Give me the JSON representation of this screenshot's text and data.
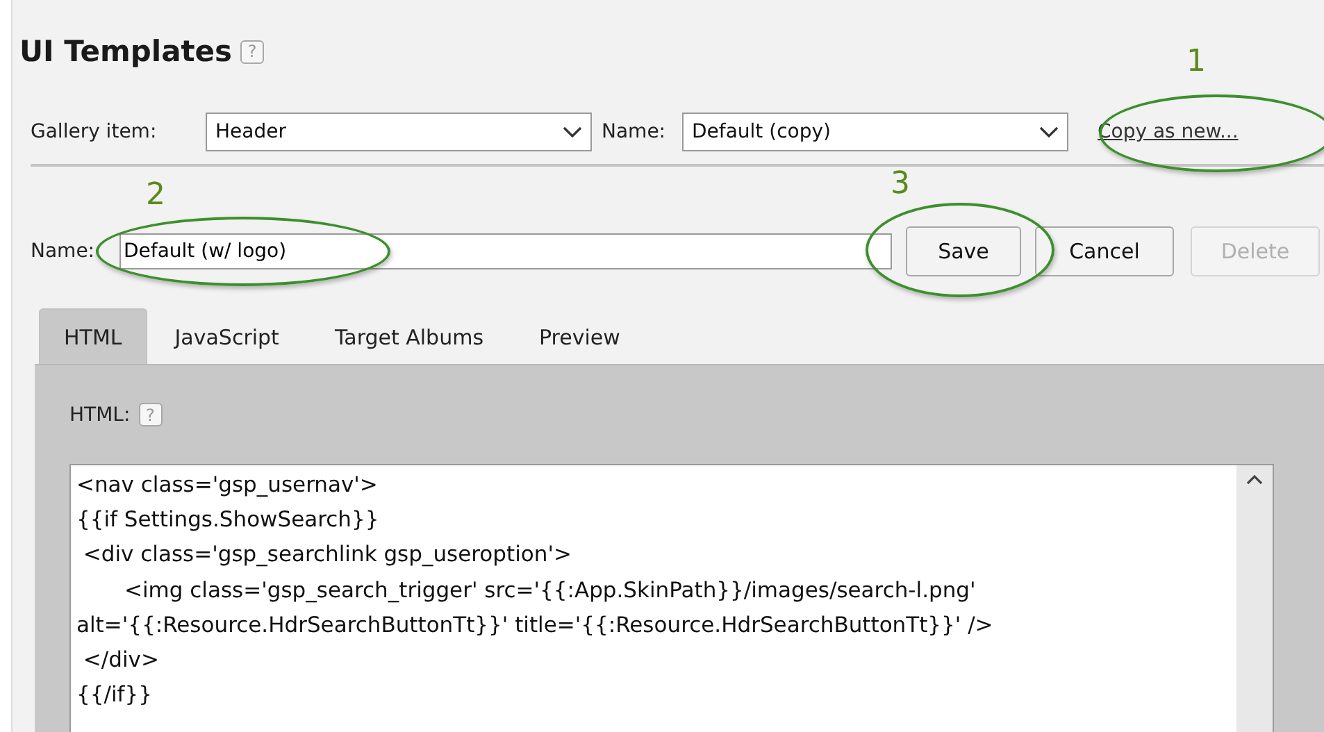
{
  "title": "UI Templates",
  "help_mark": "?",
  "picker": {
    "gallery_label": "Gallery item:",
    "gallery_value": "Header",
    "name_label": "Name:",
    "name_value": "Default (copy)",
    "copy_link": "Copy as new..."
  },
  "editor": {
    "name_label": "Name:",
    "name_value": "Default (w/ logo)",
    "buttons": [
      {
        "label": "Save",
        "disabled": false
      },
      {
        "label": "Cancel",
        "disabled": false
      },
      {
        "label": "Delete",
        "disabled": true
      }
    ]
  },
  "tabs": [
    {
      "label": "HTML",
      "selected": true
    },
    {
      "label": "JavaScript",
      "selected": false
    },
    {
      "label": "Target Albums",
      "selected": false
    },
    {
      "label": "Preview",
      "selected": false
    }
  ],
  "panel": {
    "label": "HTML:",
    "help_mark": "?",
    "code_lines": [
      "<nav class='gsp_usernav'>",
      "{{if Settings.ShowSearch}}",
      " <div class='gsp_searchlink gsp_useroption'>",
      "       <img class='gsp_search_trigger' src='{{:App.SkinPath}}/images/search-l.png'",
      "alt='{{:Resource.HdrSearchButtonTt}}' title='{{:Resource.HdrSearchButtonTt}}' />",
      " </div>",
      "{{/if}}"
    ]
  },
  "annotations": [
    {
      "number": "1"
    },
    {
      "number": "2"
    },
    {
      "number": "3"
    }
  ]
}
